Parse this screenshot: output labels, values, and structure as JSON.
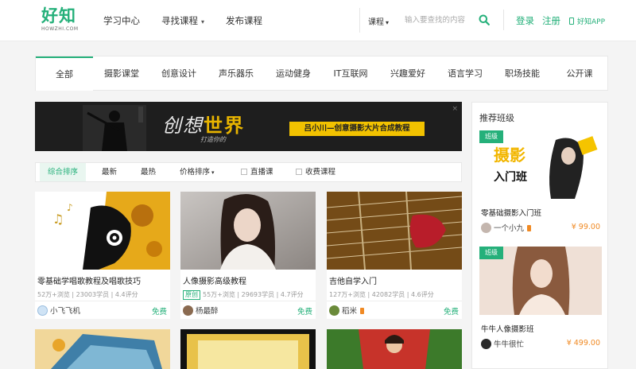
{
  "logo": {
    "cn": "好知",
    "en": "HOWZHI.COM"
  },
  "nav": [
    {
      "label": "学习中心"
    },
    {
      "label": "寻找课程"
    },
    {
      "label": "发布课程"
    }
  ],
  "search": {
    "category": "课程",
    "placeholder": "输入要查找的内容"
  },
  "header_links": {
    "login": "登录",
    "register": "注册",
    "app": "好知APP"
  },
  "categories": [
    "全部",
    "摄影课堂",
    "创意设计",
    "声乐器乐",
    "运动健身",
    "IT互联网",
    "兴趣爱好",
    "语言学习",
    "职场技能",
    "公开课"
  ],
  "banner": {
    "title_a": "创想",
    "title_b": "世界",
    "subtitle": "打造你的",
    "strip": "吕小川—创意摄影大片合成教程",
    "close": "×"
  },
  "sort": {
    "comprehensive": "综合排序",
    "newest": "最新",
    "hottest": "最热",
    "price": "价格排序",
    "live": "直播课",
    "paid": "收费课程"
  },
  "courses": [
    {
      "title": "零基础学唱歌教程及唱歌技巧",
      "meta": "52万+浏览 | 23003学员 | 4.4评分",
      "author": "小飞飞机",
      "price": "免费",
      "tag": ""
    },
    {
      "title": "人像摄影高级教程",
      "meta": "55万+浏览 | 29693学员 | 4.7评分",
      "author": "杨最醉",
      "price": "免费",
      "tag": "原创"
    },
    {
      "title": "吉他自学入门",
      "meta": "127万+浏览 | 42082学员 | 4.6评分",
      "author": "稻米",
      "price": "免费",
      "tag": ""
    }
  ],
  "sidebar": {
    "title": "推荐班级",
    "classes": [
      {
        "ribbon": "班级",
        "poster_line1": "摄影",
        "poster_line2": "入门班",
        "name": "零基础摄影入门班",
        "author": "一个小九",
        "price": "¥ 99.00"
      },
      {
        "ribbon": "班级",
        "name": "牛牛人像摄影班",
        "author": "牛牛很忙",
        "price": "¥ 499.00"
      }
    ]
  },
  "colors": {
    "brand": "#25b07a",
    "price": "#f08a24",
    "banner_strip": "#f2c200"
  }
}
